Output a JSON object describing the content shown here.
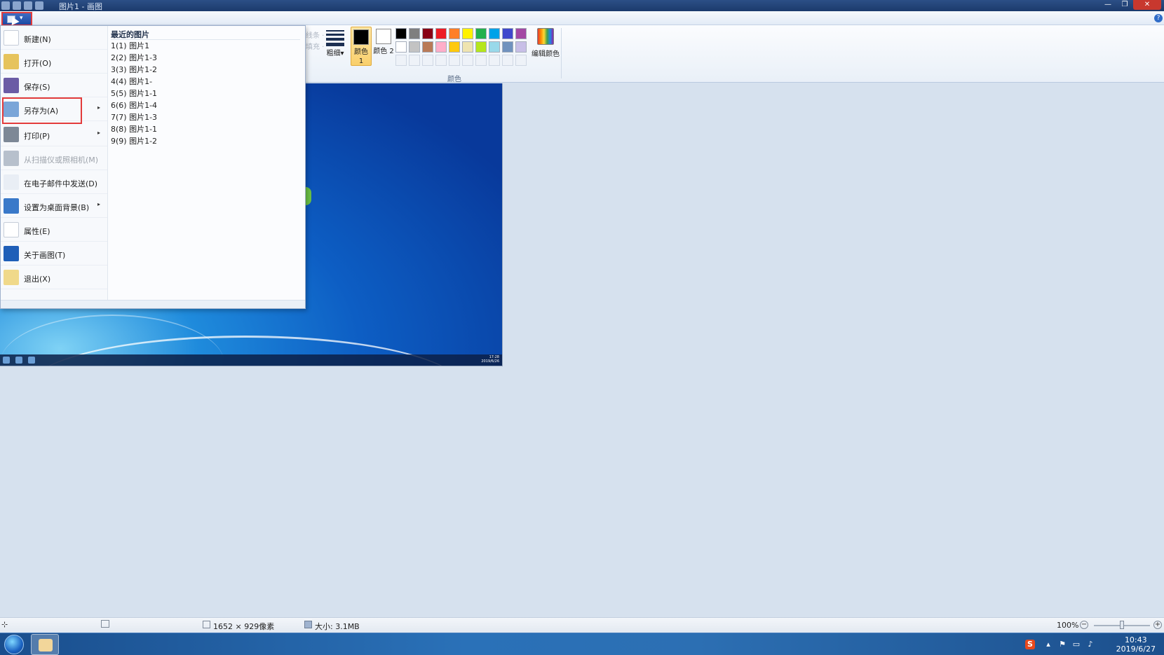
{
  "window": {
    "title": "图片1 - 画图",
    "minimize": "—",
    "restore": "❐",
    "close": "✕"
  },
  "ribbon": {
    "faint_top": "线条 ·",
    "faint_bottom": "填充 ·",
    "size_label": "粗细",
    "size_caret": "▾",
    "color1_label": "颜色 1",
    "color2_label": "颜色 2",
    "color1": "#000000",
    "color2": "#ffffff",
    "edit_colors": "编辑颜色",
    "colors_group": "颜色",
    "palette_row1": [
      "#000000",
      "#7f7f7f",
      "#880015",
      "#ed1c24",
      "#ff7f27",
      "#fff200",
      "#22b14c",
      "#00a2e8",
      "#3f48cc",
      "#a349a4"
    ],
    "palette_row2": [
      "#ffffff",
      "#c3c3c3",
      "#b97a57",
      "#ffaec9",
      "#ffc90e",
      "#efe4b0",
      "#b5e61d",
      "#99d9ea",
      "#7092be",
      "#c8bfe7"
    ]
  },
  "file_menu": {
    "items": [
      {
        "label": "新建(N)",
        "icon": "new-file-icon",
        "color": "#ffffff"
      },
      {
        "label": "打开(O)",
        "icon": "open-folder-icon",
        "color": "#e6c35c"
      },
      {
        "label": "保存(S)",
        "icon": "save-floppy-icon",
        "color": "#6b5ca5"
      },
      {
        "label": "另存为(A)",
        "icon": "save-as-icon",
        "color": "#7aa5d8",
        "submenu": "▸"
      },
      {
        "label": "打印(P)",
        "icon": "printer-icon",
        "color": "#7d8896",
        "submenu": "▸"
      },
      {
        "label": "从扫描仪或照相机(M)",
        "icon": "scanner-icon",
        "color": "#b7c0cc"
      },
      {
        "label": "在电子邮件中发送(D)",
        "icon": "email-icon",
        "color": "#e9eef5"
      },
      {
        "label": "设置为桌面背景(B)",
        "icon": "desktop-background-icon",
        "color": "#3a79c9",
        "submenu": "▸"
      },
      {
        "label": "属性(E)",
        "icon": "checkmark-icon",
        "color": "#ffffff"
      },
      {
        "label": "关于画图(T)",
        "icon": "info-icon",
        "color": "#1f5fb8"
      },
      {
        "label": "退出(X)",
        "icon": "exit-icon",
        "color": "#f0d98a"
      }
    ],
    "recent_title": "最近的图片",
    "recent": [
      "1(1) 图片1",
      "2(2) 图片1-3",
      "3(3) 图片1-2",
      "4(4) 图片1-",
      "5(5) 图片1-1",
      "6(6) 图片1-4",
      "7(7) 图片1-3",
      "8(8) 图片1-1",
      "9(9) 图片1-2"
    ]
  },
  "canvas": {
    "mini_clock_time": "17:28",
    "mini_clock_date": "2019/6/26"
  },
  "statusbar": {
    "dimensions": "1652 × 929像素",
    "size": "大小: 3.1MB",
    "zoom": "100%",
    "zoom_minus": "−",
    "zoom_plus": "+"
  },
  "taskbar": {
    "time": "10:43",
    "date": "2019/6/27",
    "ime": "S"
  }
}
